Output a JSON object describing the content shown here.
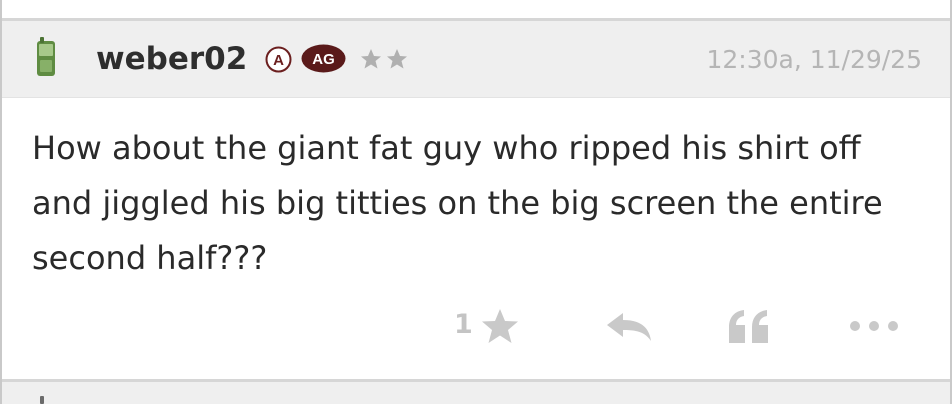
{
  "post": {
    "username": "weber02",
    "badge_a": "A",
    "badge_ag": "AG",
    "rating_stars": 2,
    "timestamp": "12:30a, 11/29/25",
    "body": "How about the giant fat guy who ripped his shirt off and jiggled his big titties on the big screen the entire second half???",
    "like_count": "1"
  },
  "icons": {
    "device": "mobile-phone-icon",
    "like": "star-icon",
    "reply": "reply-arrow-icon",
    "quote": "quote-icon",
    "more": "more-dots-icon"
  },
  "colors": {
    "header_bg": "#efefef",
    "username": "#2e2e2e",
    "ag_badge_bg": "#5a1a1a",
    "muted": "#c4c4c4",
    "phone_green": "#6a9a4a"
  }
}
